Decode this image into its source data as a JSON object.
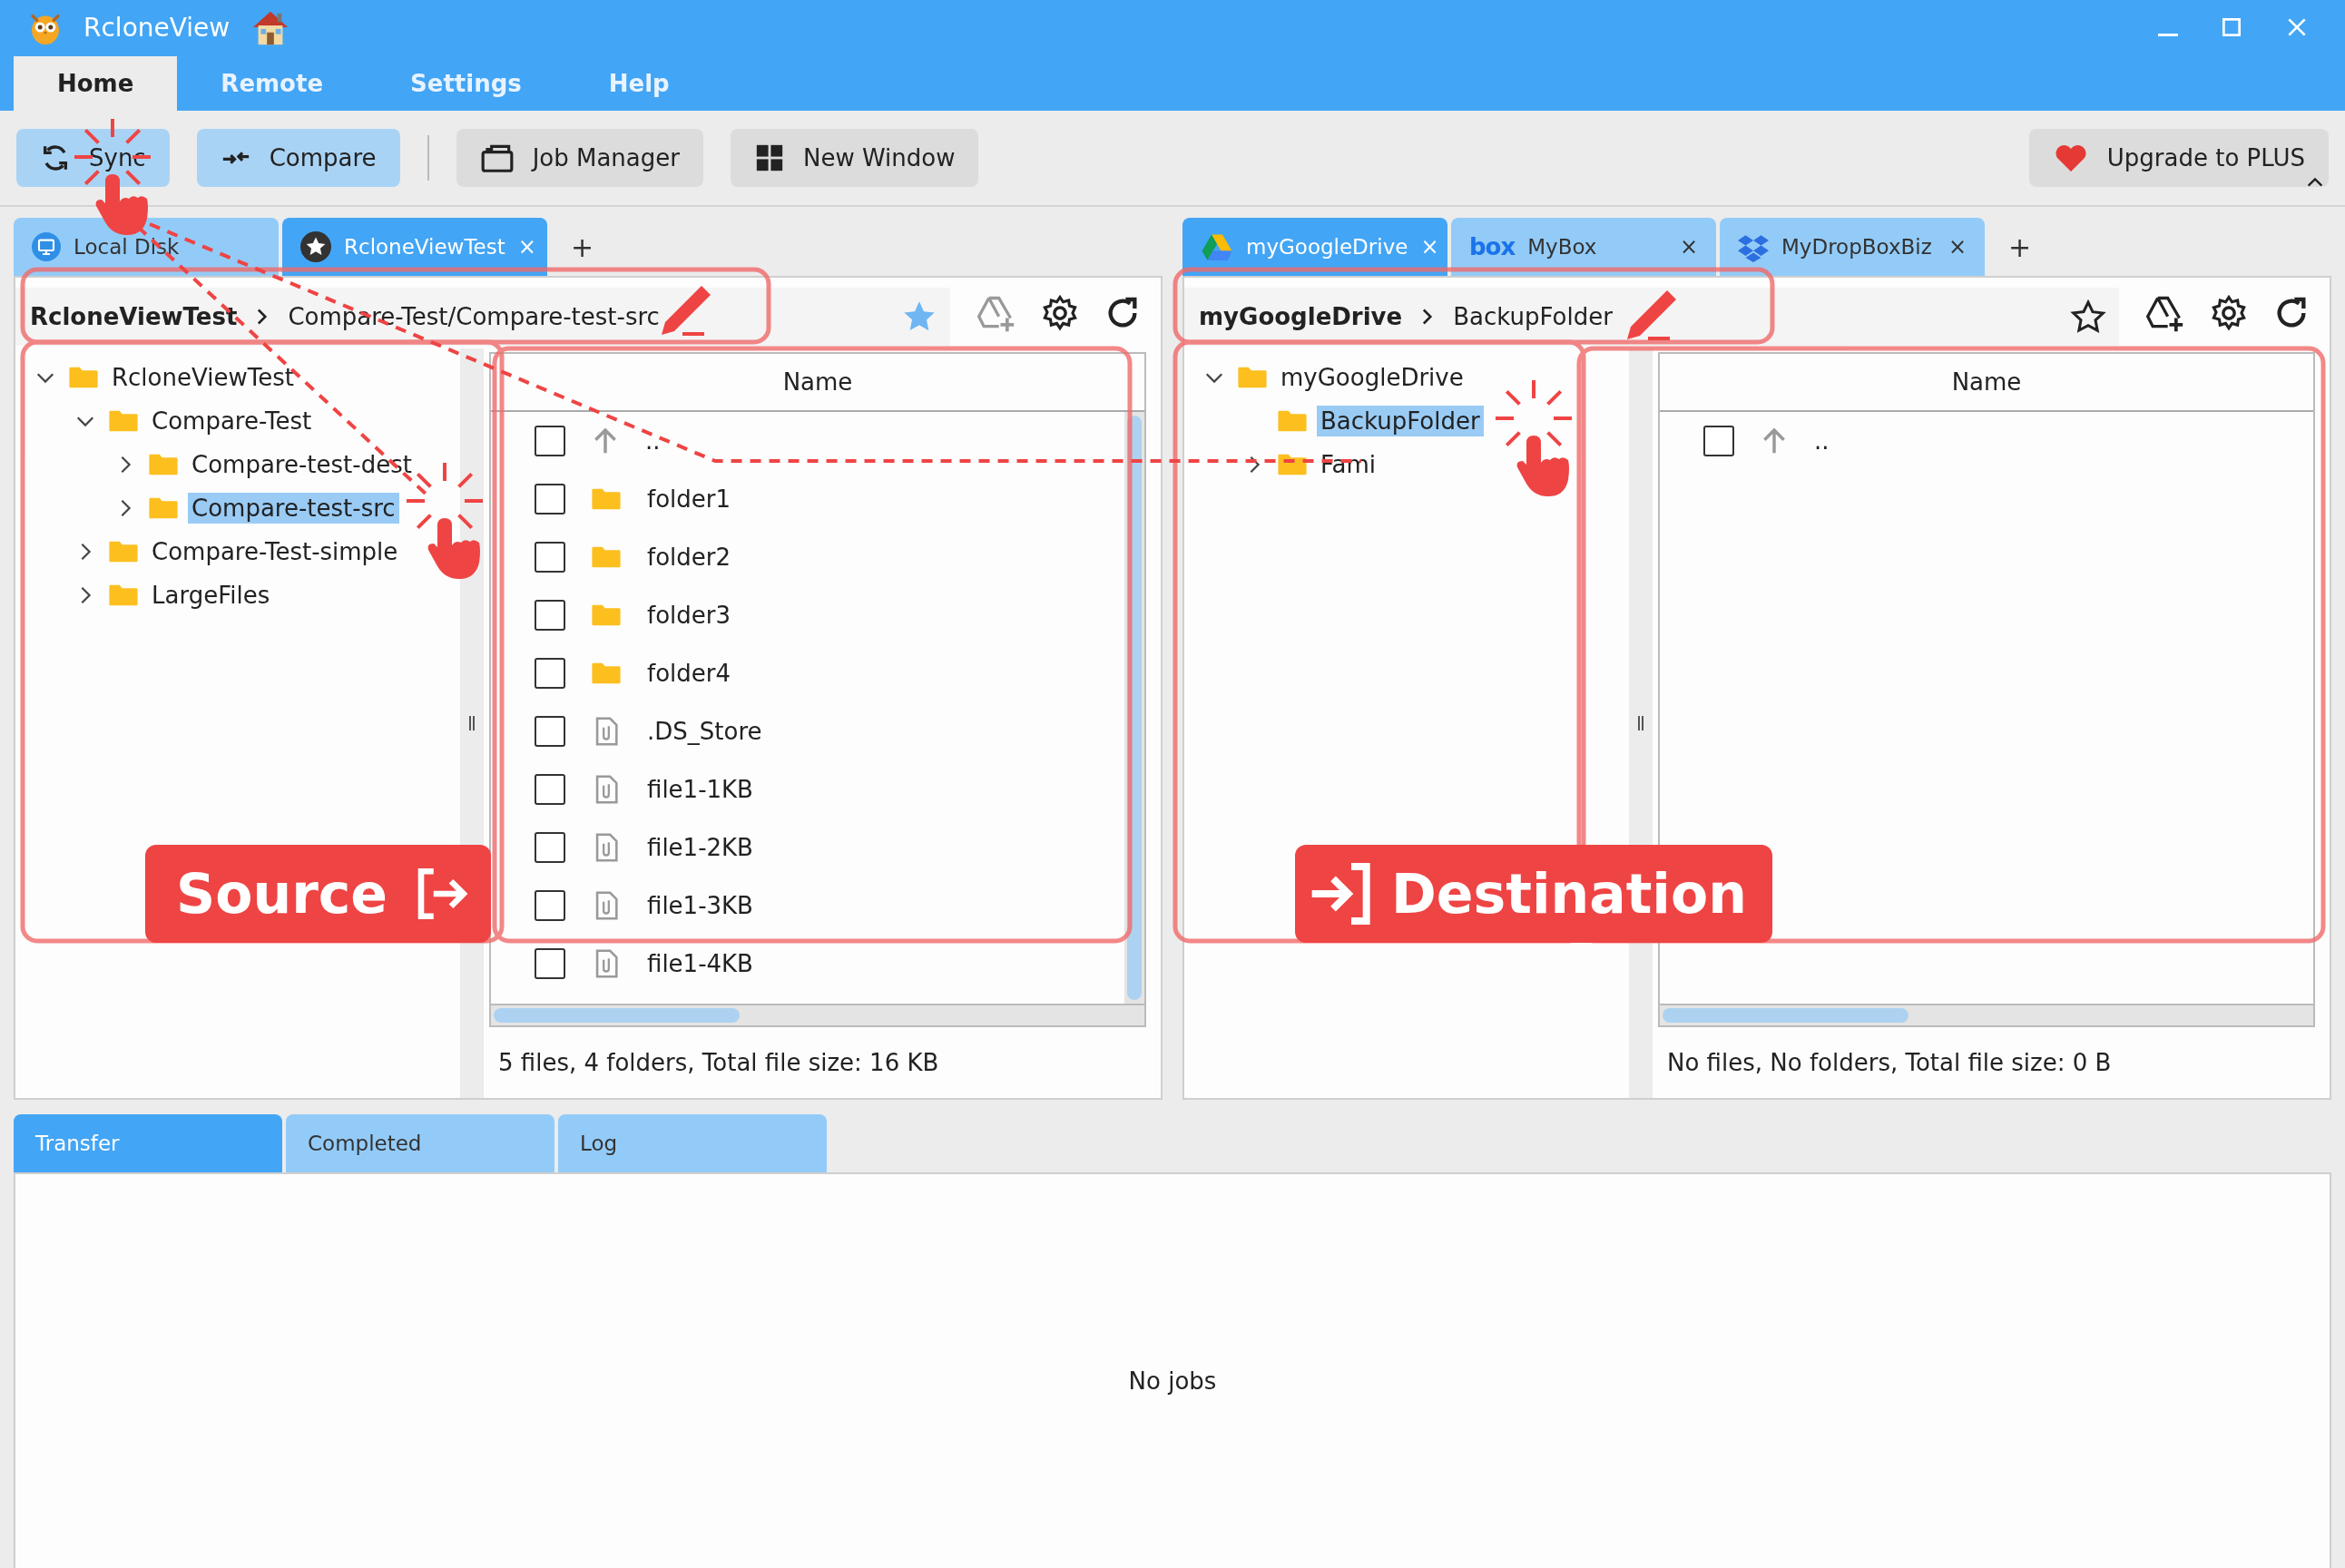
{
  "window": {
    "title": "RcloneView"
  },
  "ribbon_tabs": [
    {
      "label": "Home",
      "selected": true
    },
    {
      "label": "Remote",
      "selected": false
    },
    {
      "label": "Settings",
      "selected": false
    },
    {
      "label": "Help",
      "selected": false
    }
  ],
  "toolbar": {
    "buttons": [
      {
        "label": "Sync",
        "kind": "sync",
        "highlighted": true
      },
      {
        "label": "Compare",
        "kind": "compare",
        "highlighted": true
      },
      {
        "label": "Job Manager",
        "kind": "jobs",
        "highlighted": false
      },
      {
        "label": "New Window",
        "kind": "window",
        "highlighted": false
      }
    ],
    "upgrade": {
      "label": "Upgrade to PLUS"
    }
  },
  "panes": [
    {
      "tabs": [
        {
          "label": "Local Disk",
          "kind": "local",
          "selected": false
        },
        {
          "label": "RcloneViewTest",
          "kind": "star",
          "selected": true,
          "close": "×"
        }
      ],
      "add_tab": "+",
      "path": {
        "root": "RcloneViewTest",
        "path": "Compare-Test/Compare-test-src",
        "favorite": true
      },
      "tree": [
        {
          "label": "RcloneViewTest",
          "expanded": true,
          "selected": false,
          "children": [
            {
              "label": "Compare-Test",
              "expanded": true,
              "selected": false,
              "children": [
                {
                  "label": "Compare-test-dest",
                  "expanded": false,
                  "selected": false
                },
                {
                  "label": "Compare-test-src",
                  "expanded": false,
                  "selected": true
                }
              ]
            },
            {
              "label": "Compare-Test-simple",
              "expanded": false,
              "selected": false
            },
            {
              "label": "LargeFiles",
              "expanded": false,
              "selected": false
            }
          ]
        }
      ],
      "column_header": "Name",
      "rows": [
        {
          "name": "..",
          "kind": "up",
          "checked": false
        },
        {
          "name": "folder1",
          "kind": "folder",
          "checked": false
        },
        {
          "name": "folder2",
          "kind": "folder",
          "checked": false
        },
        {
          "name": "folder3",
          "kind": "folder",
          "checked": false
        },
        {
          "name": "folder4",
          "kind": "folder",
          "checked": false
        },
        {
          "name": ".DS_Store",
          "kind": "file",
          "checked": false
        },
        {
          "name": "file1-1KB",
          "kind": "file",
          "checked": false
        },
        {
          "name": "file1-2KB",
          "kind": "file",
          "checked": false
        },
        {
          "name": "file1-3KB",
          "kind": "file",
          "checked": false
        },
        {
          "name": "file1-4KB",
          "kind": "file",
          "checked": false
        }
      ],
      "status": "5 files, 4 folders, Total file size: 16 KB",
      "callout": {
        "label": "Source",
        "kind": "source"
      }
    },
    {
      "tabs": [
        {
          "label": "myGoogleDrive",
          "kind": "gdrive",
          "selected": true,
          "close": "×"
        },
        {
          "label": "MyBox",
          "kind": "box",
          "logo": "box",
          "selected": false,
          "close": "×"
        },
        {
          "label": "MyDropBoxBiz",
          "kind": "dropbox",
          "selected": false,
          "close": "×"
        }
      ],
      "add_tab": "+",
      "path": {
        "root": "myGoogleDrive",
        "path": "BackupFolder",
        "favorite": false
      },
      "tree": [
        {
          "label": "myGoogleDrive",
          "expanded": true,
          "selected": false,
          "children": [
            {
              "label": "BackupFolder",
              "selected": true
            },
            {
              "label": "Fami",
              "expanded": false,
              "selected": false
            }
          ]
        }
      ],
      "column_header": "Name",
      "rows": [
        {
          "name": "..",
          "kind": "up",
          "checked": false
        }
      ],
      "status": "No files, No folders, Total file size: 0 B",
      "callout": {
        "label": "Destination",
        "kind": "destination"
      }
    }
  ],
  "bottom": {
    "tabs": [
      {
        "label": "Transfer",
        "selected": true
      },
      {
        "label": "Completed",
        "selected": false
      },
      {
        "label": "Log",
        "selected": false
      }
    ],
    "empty_message": "No jobs"
  }
}
